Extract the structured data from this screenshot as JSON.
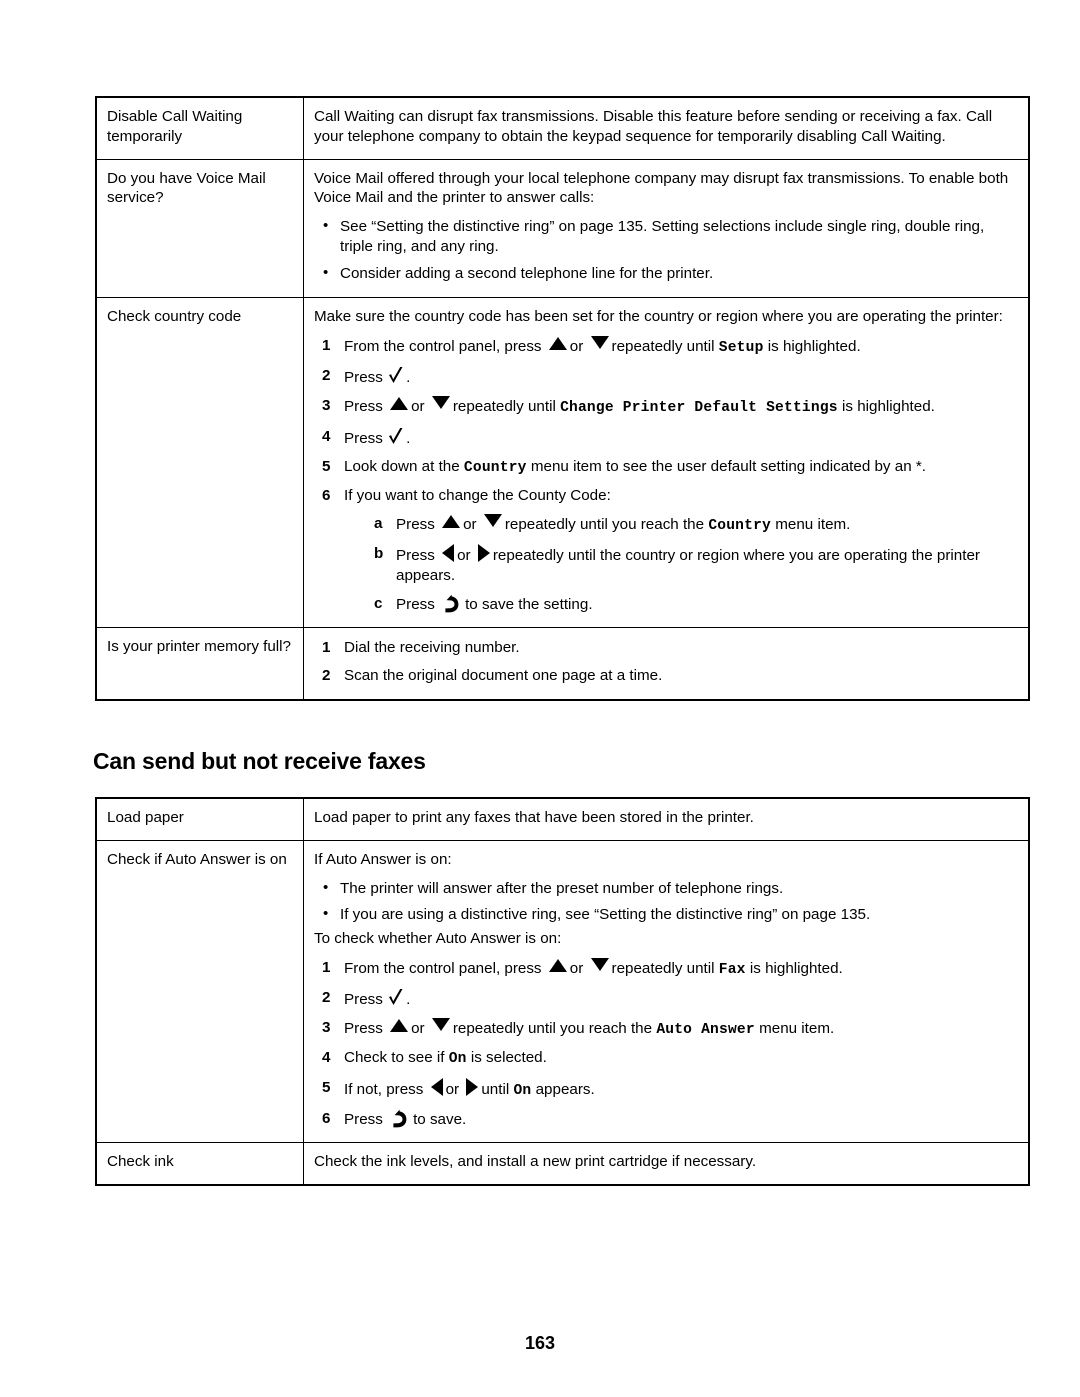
{
  "document": {
    "page_number": "163",
    "section_heading": "Can send but not receive faxes"
  },
  "icons": {
    "up_arrow": "up-arrow-icon",
    "down_arrow": "down-arrow-icon",
    "left_arrow": "left-arrow-icon",
    "right_arrow": "right-arrow-icon",
    "select_check": "checkmark-select-icon",
    "back_return": "back-return-icon"
  },
  "table_send": {
    "rows": [
      {
        "issue": "Disable Call Waiting temporarily",
        "body": "Call Waiting can disrupt fax transmissions. Disable this feature before sending or receiving a fax. Call your telephone company to obtain the keypad sequence for temporarily disabling Call Waiting."
      },
      {
        "issue": "Do you have Voice Mail service?",
        "intro": "Voice Mail offered through your local telephone company may disrupt fax transmissions. To enable both Voice Mail and the printer to answer calls:",
        "bullets": [
          "See “Setting the distinctive ring” on page 135. Setting selections include single ring, double ring, triple ring, and any ring.",
          "Consider adding a second telephone line for the printer."
        ]
      },
      {
        "issue": "Check country code",
        "intro": "Make sure the country code has been set for the country or region where you are operating the printer:",
        "steps": {
          "s1_a": "From the control panel, press",
          "s1_b": "or",
          "s1_c": "repeatedly until",
          "s1_menu": "Setup",
          "s1_d": "is highlighted.",
          "s2_a": "Press",
          "s2_b": ".",
          "s3_a": "Press",
          "s3_b": "or",
          "s3_c": "repeatedly until",
          "s3_menu": "Change Printer Default Settings",
          "s3_d": "is highlighted.",
          "s4_a": "Press",
          "s4_b": ".",
          "s5_a": "Look down at the",
          "s5_menu": "Country",
          "s5_b": "menu item to see the user default setting indicated by an *.",
          "s6_a": "If you want to change the County Code:",
          "s6a_a": "Press",
          "s6a_b": "or",
          "s6a_c": "repeatedly until you reach the",
          "s6a_menu": "Country",
          "s6a_d": "menu item.",
          "s6b_a": "Press",
          "s6b_b": "or",
          "s6b_c": "repeatedly until the country or region where you are operating the printer appears.",
          "s6c_a": "Press",
          "s6c_b": "to save the setting.",
          "labels": {
            "n1": "1",
            "n2": "2",
            "n3": "3",
            "n4": "4",
            "n5": "5",
            "n6": "6",
            "a": "a",
            "b": "b",
            "c": "c"
          }
        }
      },
      {
        "issue": "Is your printer memory full?",
        "steps": {
          "n1": "1",
          "t1": "Dial the receiving number.",
          "n2": "2",
          "t2": "Scan the original document one page at a time."
        }
      }
    ]
  },
  "table_receive": {
    "rows": [
      {
        "issue": "Load paper",
        "body": "Load paper to print any faxes that have been stored in the printer."
      },
      {
        "issue": "Check if Auto Answer is on",
        "intro": "If Auto Answer is on:",
        "bullets": [
          "The printer will answer after the preset number of telephone rings.",
          "If you are using a distinctive ring, see “Setting the distinctive ring” on page 135."
        ],
        "mid": "To check whether Auto Answer is on:",
        "steps": {
          "s1_a": "From the control panel, press",
          "s1_b": "or",
          "s1_c": "repeatedly until",
          "s1_menu": "Fax",
          "s1_d": "is highlighted.",
          "s2_a": "Press",
          "s2_b": ".",
          "s3_a": "Press",
          "s3_b": "or",
          "s3_c": "repeatedly until you reach the",
          "s3_menu": "Auto Answer",
          "s3_d": "menu item.",
          "s4_a": "Check to see if",
          "s4_menu": "On",
          "s4_b": "is selected.",
          "s5_a": "If not, press",
          "s5_b": "or",
          "s5_c": "until",
          "s5_menu": "On",
          "s5_d": "appears.",
          "s6_a": "Press",
          "s6_b": "to save.",
          "labels": {
            "n1": "1",
            "n2": "2",
            "n3": "3",
            "n4": "4",
            "n5": "5",
            "n6": "6"
          }
        }
      },
      {
        "issue": "Check ink",
        "body": "Check the ink levels, and install a new print cartridge if necessary."
      }
    ]
  }
}
